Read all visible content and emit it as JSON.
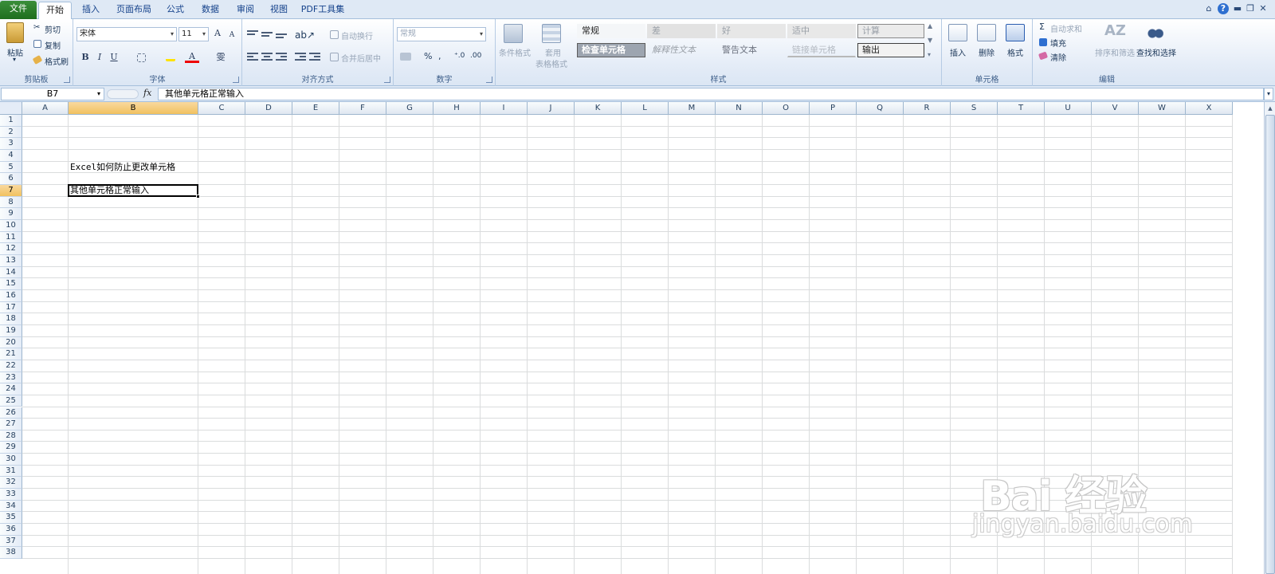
{
  "tabs": [
    {
      "label": "文件",
      "kind": "file"
    },
    {
      "label": "开始",
      "kind": "active"
    },
    {
      "label": "插入"
    },
    {
      "label": "页面布局"
    },
    {
      "label": "公式"
    },
    {
      "label": "数据"
    },
    {
      "label": "审阅"
    },
    {
      "label": "视图"
    },
    {
      "label": "PDF工具集"
    }
  ],
  "clipboard": {
    "paste": "粘贴",
    "cut": "剪切",
    "copy": "复制",
    "format_painter": "格式刷",
    "label": "剪贴板"
  },
  "font": {
    "name": "宋体",
    "size": "11",
    "grow": "A",
    "shrink": "A",
    "bold": "B",
    "italic": "I",
    "underline": "U",
    "font_color": "A",
    "phonetic": "雯",
    "label": "字体"
  },
  "alignment": {
    "wrap": "自动换行",
    "merge": "合并后居中",
    "label": "对齐方式"
  },
  "number": {
    "format": "常规",
    "percent": "%",
    "comma": ",",
    "label": "数字"
  },
  "styles": {
    "conditional": "条件格式",
    "table_line1": "套用",
    "table_line2": "表格格式",
    "cells": [
      {
        "text": "常规"
      },
      {
        "text": "差"
      },
      {
        "text": "好"
      },
      {
        "text": "适中"
      },
      {
        "text": "计算"
      },
      {
        "text": "检查单元格"
      },
      {
        "text": "解释性文本"
      },
      {
        "text": "警告文本"
      },
      {
        "text": "链接单元格"
      },
      {
        "text": "输出"
      }
    ],
    "label": "样式"
  },
  "cells_group": {
    "insert": "插入",
    "delete": "删除",
    "format": "格式",
    "label": "单元格"
  },
  "editing": {
    "autosum": "自动求和",
    "fill": "填充",
    "clear": "清除",
    "sort": "排序和筛选",
    "find": "查找和选择",
    "label": "编辑"
  },
  "formula_bar": {
    "name_box": "B7",
    "fx": "fx",
    "content": "其他单元格正常输入"
  },
  "columns": [
    "A",
    "B",
    "C",
    "D",
    "E",
    "F",
    "G",
    "H",
    "I",
    "J",
    "K",
    "L",
    "M",
    "N",
    "O",
    "P",
    "Q",
    "R",
    "S",
    "T",
    "U",
    "V",
    "W",
    "X"
  ],
  "selected": {
    "col": "B",
    "row": 7
  },
  "cells": [
    {
      "ref": "B5",
      "text": "Excel如何防止更改单元格"
    },
    {
      "ref": "B7",
      "text": "其他单元格正常输入"
    }
  ],
  "row_count": 38,
  "watermark": {
    "brand": "Bai 经验",
    "url": "jingyan.baidu.com"
  }
}
